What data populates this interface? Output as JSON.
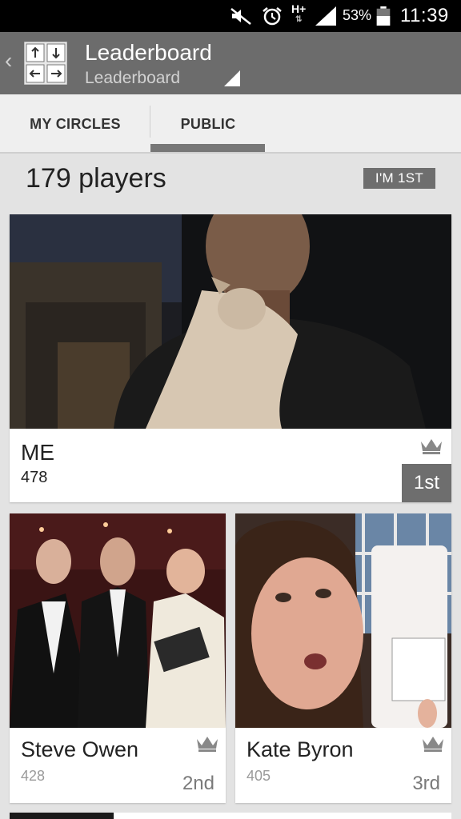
{
  "status_bar": {
    "battery_percent": "53%",
    "time": "11:39",
    "network": "H+",
    "icons": [
      "mute-icon",
      "alarm-icon",
      "network-hplus-icon",
      "signal-icon",
      "battery-icon"
    ]
  },
  "action_bar": {
    "title": "Leaderboard",
    "subtitle": "Leaderboard",
    "back_icon": "back-chevron-icon",
    "logo_icon": "game-logo-icon"
  },
  "tabs": [
    {
      "label": "MY CIRCLES",
      "selected": false
    },
    {
      "label": "PUBLIC",
      "selected": true
    }
  ],
  "leaderboard": {
    "players_count": "179 players",
    "jump_button": "I'M 1ST"
  },
  "entries": [
    {
      "name": "ME",
      "score": "478",
      "rank": "1st",
      "crown": "crown-icon"
    },
    {
      "name": "Steve Owen",
      "score": "428",
      "rank": "2nd",
      "crown": "crown-icon"
    },
    {
      "name": "Kate Byron",
      "score": "405",
      "rank": "3rd",
      "crown": "crown-icon"
    }
  ],
  "colors": {
    "status_bar": "#000000",
    "action_bar": "#6c6c6c",
    "tab_bar": "#efefef",
    "tab_indicator": "#777777",
    "background": "#e3e3e3",
    "badge": "#6e6e6e"
  }
}
